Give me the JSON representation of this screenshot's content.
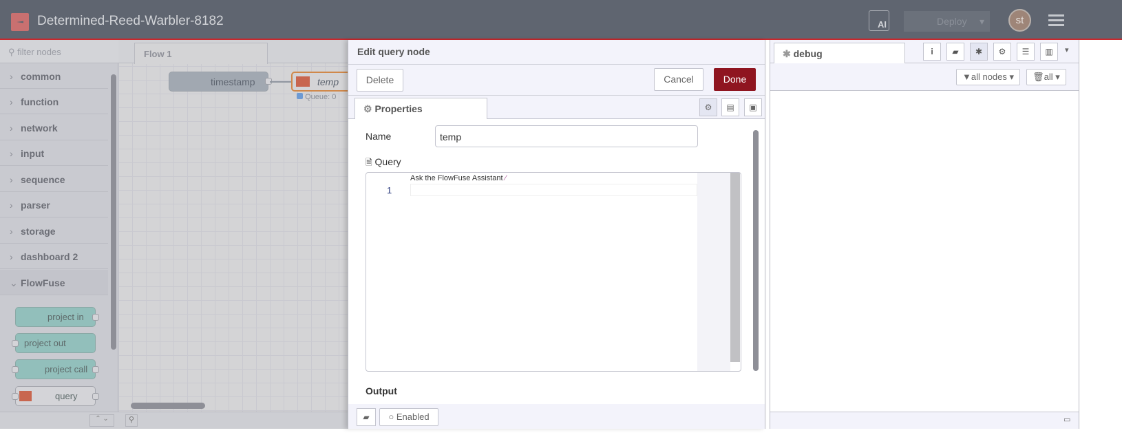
{
  "header": {
    "title": "Determined-Reed-Warbler-8182",
    "ai_label": "AI",
    "deploy_label": "Deploy",
    "avatar_initials": "st"
  },
  "palette": {
    "filter_placeholder": "filter nodes",
    "categories": [
      "common",
      "function",
      "network",
      "input",
      "sequence",
      "parser",
      "storage",
      "dashboard 2",
      "FlowFuse"
    ],
    "flowfuse_nodes": [
      "project in",
      "project out",
      "project call",
      "query"
    ]
  },
  "workspace": {
    "tab": "Flow 1",
    "nodes": {
      "timestamp": "timestamp",
      "temp": "temp",
      "temp_status": "Queue: 0"
    }
  },
  "tray": {
    "title": "Edit query node",
    "delete": "Delete",
    "cancel": "Cancel",
    "done": "Done",
    "tab": "Properties",
    "name_label": "Name",
    "name_value": "temp",
    "query_label": "Query",
    "assistant_hint": "Ask the FlowFuse Assistant",
    "line_number": "1",
    "output_label": "Output",
    "enabled_label": "Enabled"
  },
  "sidebar": {
    "tab": "debug",
    "filter_nodes": "all nodes",
    "clear_label": "all"
  },
  "colors": {
    "header": "#5f6570",
    "accent": "#c8282d",
    "done": "#8f1520",
    "flowfuse_node": "#92bfbb"
  }
}
